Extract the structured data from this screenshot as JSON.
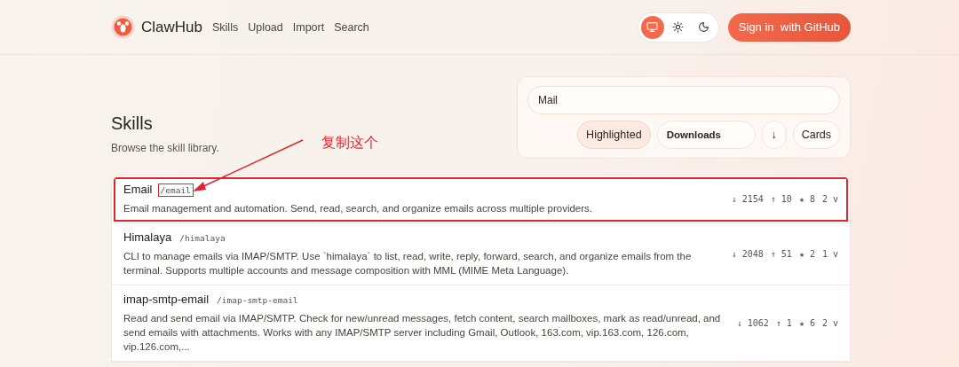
{
  "header": {
    "brand": "ClawHub",
    "nav": [
      {
        "label": "Skills"
      },
      {
        "label": "Upload"
      },
      {
        "label": "Import"
      },
      {
        "label": "Search"
      }
    ],
    "theme_options": [
      {
        "kind": "system",
        "selected": true
      },
      {
        "kind": "light",
        "selected": false
      },
      {
        "kind": "dark",
        "selected": false
      }
    ],
    "sign_in": "Sign in  with GitHub"
  },
  "page": {
    "title": "Skills",
    "subtitle": "Browse the skill library."
  },
  "filters": {
    "search_value": "Mail",
    "highlighted": {
      "label": "Highlighted",
      "selected": true
    },
    "sort": "Downloads",
    "direction": "↓",
    "view": "Cards"
  },
  "annotation": {
    "text": "复制这个"
  },
  "skills": [
    {
      "name": "Email",
      "slug": "/email",
      "annotated": true,
      "description": "Email management and automation. Send, read, search, and organize emails across multiple providers.",
      "downloads": "↓ 2154",
      "installs": "↑ 10",
      "stars": "★ 8",
      "versions": "2 v"
    },
    {
      "name": "Himalaya",
      "slug": "/himalaya",
      "annotated": false,
      "description": "CLI to manage emails via IMAP/SMTP. Use `himalaya` to list, read, write, reply, forward, search, and organize emails from the terminal. Supports multiple accounts and message composition with MML (MIME Meta Language).",
      "downloads": "↓ 2048",
      "installs": "↑ 51",
      "stars": "★ 2",
      "versions": "1 v"
    },
    {
      "name": "imap-smtp-email",
      "slug": "/imap-smtp-email",
      "annotated": false,
      "description": "Read and send email via IMAP/SMTP. Check for new/unread messages, fetch content, search mailboxes, mark as read/unread, and send emails with attachments. Works with any IMAP/SMTP server including Gmail, Outlook, 163.com, vip.163.com, 126.com, vip.126.com,...",
      "downloads": "↓ 1062",
      "installs": "↑ 1",
      "stars": "★ 6",
      "versions": "2 v"
    }
  ]
}
